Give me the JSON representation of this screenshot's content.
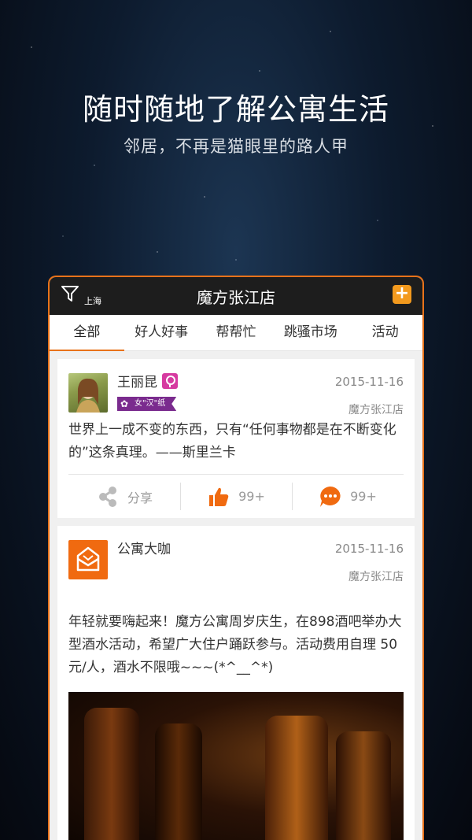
{
  "hero": {
    "title": "随时随地了解公寓生活",
    "subtitle": "邻居，不再是猫眼里的路人甲"
  },
  "topbar": {
    "city": "上海",
    "store_name": "魔方张江店",
    "add_label": "+"
  },
  "tabs": [
    {
      "label": "全部",
      "active": true
    },
    {
      "label": "好人好事",
      "active": false
    },
    {
      "label": "帮帮忙",
      "active": false
    },
    {
      "label": "跳骚市场",
      "active": false
    },
    {
      "label": "活动",
      "active": false
    }
  ],
  "posts": [
    {
      "user": "王丽昆",
      "tag": "女\"汉\"纸",
      "date": "2015-11-16",
      "shop": "魔方张江店",
      "content": "世界上一成不变的东西，只有“任何事物都是在不断变化的”这条真理。——斯里兰卡",
      "share_label": "分享",
      "like_count": "99+",
      "comment_count": "99+"
    },
    {
      "user": "公寓大咖",
      "date": "2015-11-16",
      "shop": "魔方张江店",
      "content": "年轻就要嗨起来！魔方公寓周岁庆生，在898酒吧举办大型酒水活动，希望广大住户踊跃参与。活动费用自理 50元/人，酒水不限哦~~~(*^__^*)"
    }
  ],
  "colors": {
    "accent": "#e8721a",
    "badge_female": "#d63aa0",
    "tag_bg": "#7a2b8e"
  }
}
